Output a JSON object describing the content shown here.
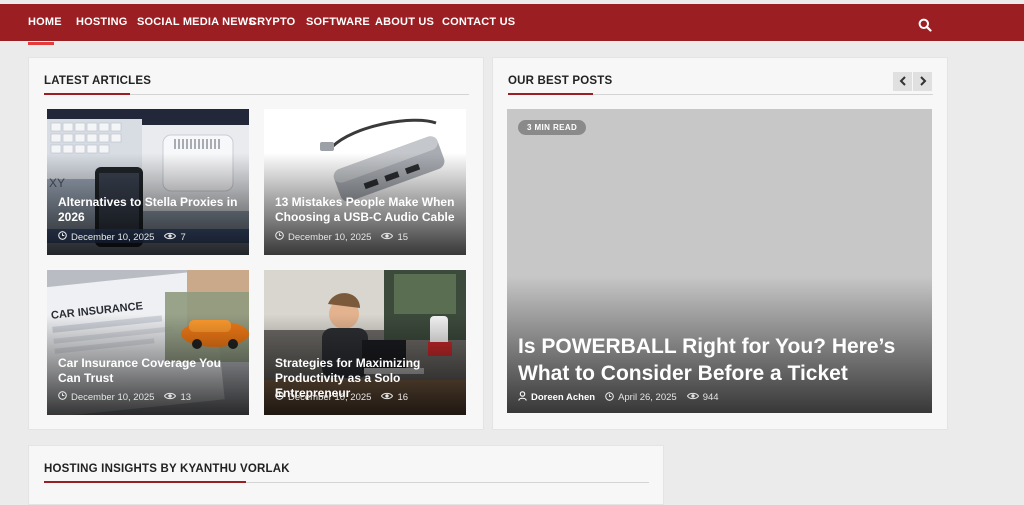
{
  "nav": {
    "items": [
      {
        "label": "HOME",
        "active": true
      },
      {
        "label": "HOSTING"
      },
      {
        "label": "SOCIAL MEDIA NEWS"
      },
      {
        "label": "CRYPTO"
      },
      {
        "label": "SOFTWARE"
      },
      {
        "label": "ABOUT US"
      },
      {
        "label": "CONTACT US"
      }
    ],
    "search_icon": "search-icon",
    "bg_color": "#9b1e22"
  },
  "latest": {
    "title": "LATEST ARTICLES",
    "articles": [
      {
        "title": "Alternatives to Stella Proxies in 2026",
        "date": "December 10, 2025",
        "views": "7"
      },
      {
        "title": "13 Mistakes People Make When Choosing a USB-C Audio Cable",
        "date": "December 10, 2025",
        "views": "15"
      },
      {
        "title": "Car Insurance Coverage You Can Trust",
        "date": "December 10, 2025",
        "views": "13"
      },
      {
        "title": "Strategies for Maximizing Productivity as a Solo Entrepreneur",
        "date": "December 10, 2025",
        "views": "16"
      }
    ]
  },
  "best": {
    "title": "OUR BEST POSTS",
    "prev_icon": "chevron-left-icon",
    "next_icon": "chevron-right-icon",
    "post": {
      "badge": "3 MIN READ",
      "title": "Is POWERBALL Right for You? Here’s What to Consider Before a Ticket",
      "author": "Doreen Achen",
      "date": "April 26, 2025",
      "views": "944"
    }
  },
  "hosting": {
    "title": "HOSTING INSIGHTS BY KYANTHU VORLAK"
  }
}
